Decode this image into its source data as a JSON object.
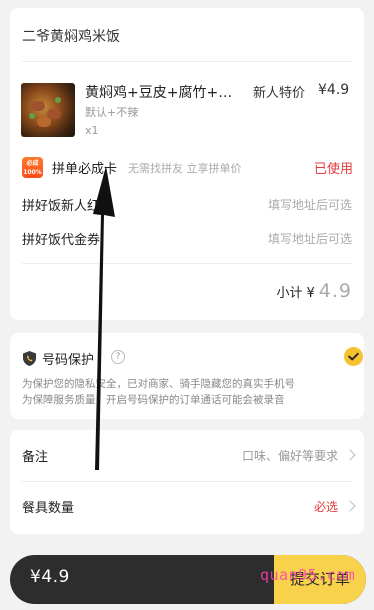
{
  "store": {
    "name": "二爷黄焖鸡米饭"
  },
  "item": {
    "name": "黄焖鸡+豆皮+腐竹+…",
    "spec": "默认+不辣",
    "qty": "x1",
    "special_label": "新人特价",
    "price": "¥4.9"
  },
  "group_card": {
    "badge_line1": "必成",
    "badge_line2": "100%",
    "title": "拼单必成卡",
    "desc": "无需找拼友 立享拼单价",
    "status": "已使用"
  },
  "rows": {
    "new_user_label": "拼好饭新人红包",
    "new_user_hint": "填写地址后可选",
    "voucher_label": "拼好饭代金券",
    "voucher_hint": "填写地址后可选"
  },
  "subtotal": {
    "label": "小计",
    "currency": "¥",
    "value": "4.9"
  },
  "privacy": {
    "title": "号码保护",
    "help_glyph": "?",
    "line1": "为保护您的隐私安全，已对商家、骑手隐藏您的真实手机号",
    "line2": "为保障服务质量，开启号码保护的订单通话可能会被录音"
  },
  "remarks": {
    "note_label": "备注",
    "note_placeholder": "口味、偏好等要求",
    "utensils_label": "餐具数量",
    "utensils_value": "必选"
  },
  "footer": {
    "total": "¥4.9",
    "submit_label": "提交订单",
    "watermark": "quan95.com"
  },
  "colors": {
    "accent_yellow": "#f8d24a",
    "alert_red": "#e4393c",
    "bar_dark": "#2d2d2d",
    "watermark_pink": "#ff3fb6"
  },
  "icons": [
    "shield-icon",
    "help-icon",
    "check-icon",
    "chevron-right-icon",
    "arrow-annotation"
  ]
}
